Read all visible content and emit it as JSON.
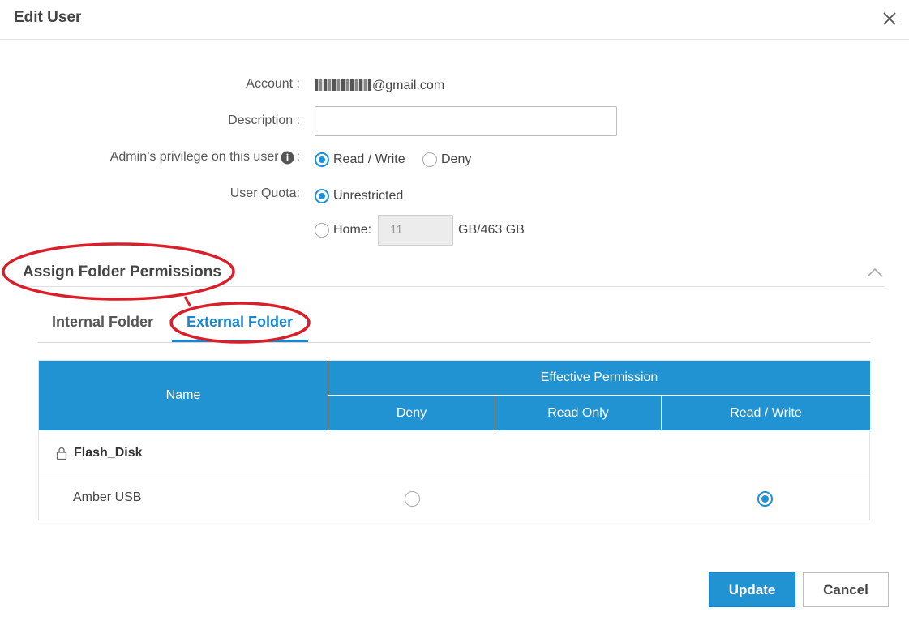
{
  "dialog": {
    "title": "Edit User"
  },
  "form": {
    "account_label": "Account :",
    "account_suffix": "@gmail.com",
    "description_label": "Description :",
    "description_value": "",
    "privilege_label": "Admin’s privilege on this user",
    "privilege_colon": ":",
    "privilege_options": [
      "Read / Write",
      "Deny"
    ],
    "privilege_selected": "Read / Write",
    "quota_label": "User Quota:",
    "quota_unrestricted": "Unrestricted",
    "quota_home": "Home:",
    "quota_value": "11",
    "quota_unit": "GB/463 GB",
    "quota_selected": "Unrestricted"
  },
  "section": {
    "title": "Assign Folder Permissions"
  },
  "tabs": [
    {
      "label": "Internal Folder",
      "active": false
    },
    {
      "label": "External Folder",
      "active": true
    }
  ],
  "table": {
    "name_header": "Name",
    "effective_header": "Effective Permission",
    "columns": [
      "Deny",
      "Read Only",
      "Read / Write"
    ],
    "group": "Flash_Disk",
    "rows": [
      {
        "name": "Amber USB",
        "selected": "Read / Write"
      }
    ]
  },
  "buttons": {
    "update": "Update",
    "cancel": "Cancel"
  },
  "colors": {
    "accent": "#2193d2",
    "annotation": "#d8202a"
  },
  "icons": [
    "close-icon",
    "info-icon",
    "chevron-up-icon",
    "lock-icon"
  ]
}
